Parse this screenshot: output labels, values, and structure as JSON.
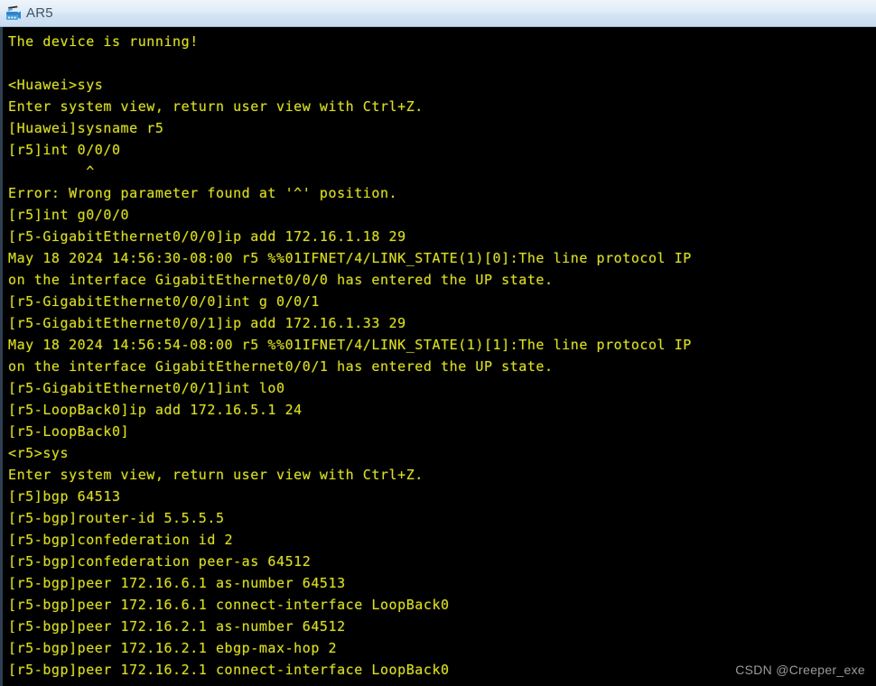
{
  "window": {
    "title": "AR5",
    "icon": "router-device-icon",
    "background_color": "#000000",
    "text_color": "#d9dd23",
    "titlebar_color": "#d3e3f4"
  },
  "terminal": {
    "lines": [
      "The device is running!",
      "",
      "<Huawei>sys",
      "Enter system view, return user view with Ctrl+Z.",
      "[Huawei]sysname r5",
      "[r5]int 0/0/0",
      "         ^",
      "Error: Wrong parameter found at '^' position.",
      "[r5]int g0/0/0",
      "[r5-GigabitEthernet0/0/0]ip add 172.16.1.18 29",
      "May 18 2024 14:56:30-08:00 r5 %%01IFNET/4/LINK_STATE(1)[0]:The line protocol IP",
      "on the interface GigabitEthernet0/0/0 has entered the UP state.",
      "[r5-GigabitEthernet0/0/0]int g 0/0/1",
      "[r5-GigabitEthernet0/0/1]ip add 172.16.1.33 29",
      "May 18 2024 14:56:54-08:00 r5 %%01IFNET/4/LINK_STATE(1)[1]:The line protocol IP",
      "on the interface GigabitEthernet0/0/1 has entered the UP state.",
      "[r5-GigabitEthernet0/0/1]int lo0",
      "[r5-LoopBack0]ip add 172.16.5.1 24",
      "[r5-LoopBack0]",
      "<r5>sys",
      "Enter system view, return user view with Ctrl+Z.",
      "[r5]bgp 64513",
      "[r5-bgp]router-id 5.5.5.5",
      "[r5-bgp]confederation id 2",
      "[r5-bgp]confederation peer-as 64512",
      "[r5-bgp]peer 172.16.6.1 as-number 64513",
      "[r5-bgp]peer 172.16.6.1 connect-interface LoopBack0",
      "[r5-bgp]peer 172.16.2.1 as-number 64512",
      "[r5-bgp]peer 172.16.2.1 ebgp-max-hop 2",
      "[r5-bgp]peer 172.16.2.1 connect-interface LoopBack0"
    ]
  },
  "watermark": {
    "text": "CSDN @Creeper_exe"
  }
}
